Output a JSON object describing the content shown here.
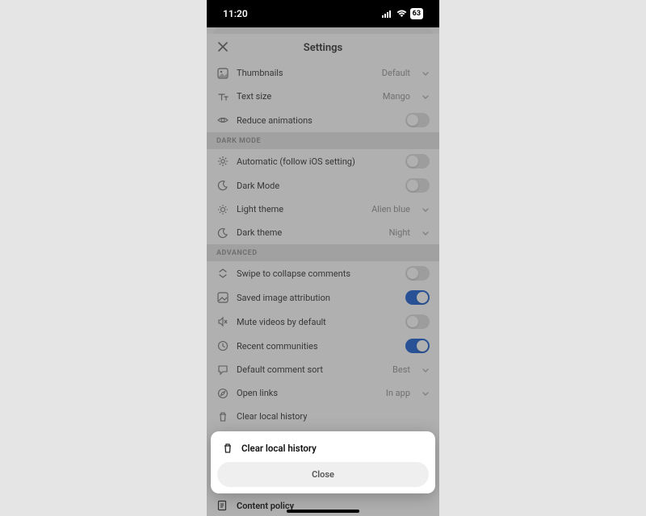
{
  "statusbar": {
    "time": "11:20",
    "battery": "63"
  },
  "header": {
    "title": "Settings"
  },
  "view_section": {
    "thumbnails": {
      "label": "Thumbnails",
      "value": "Default"
    },
    "textsize": {
      "label": "Text size",
      "value": "Mango"
    },
    "reduce_anim": {
      "label": "Reduce animations"
    }
  },
  "dark_section": {
    "head": "DARK MODE",
    "auto": {
      "label": "Automatic (follow iOS setting)"
    },
    "darkmode": {
      "label": "Dark Mode"
    },
    "light": {
      "label": "Light theme",
      "value": "Alien blue"
    },
    "dark": {
      "label": "Dark theme",
      "value": "Night"
    }
  },
  "adv_section": {
    "head": "ADVANCED",
    "swipe": {
      "label": "Swipe to collapse comments"
    },
    "attrib": {
      "label": "Saved image attribution"
    },
    "mute": {
      "label": "Mute videos by default"
    },
    "recent": {
      "label": "Recent communities"
    },
    "sort": {
      "label": "Default comment sort",
      "value": "Best"
    },
    "open": {
      "label": "Open links",
      "value": "In app"
    },
    "clear": {
      "label": "Clear local history"
    }
  },
  "bottom": {
    "content_policy": "Content policy"
  },
  "sheet": {
    "title": "Clear local history",
    "close": "Close"
  }
}
